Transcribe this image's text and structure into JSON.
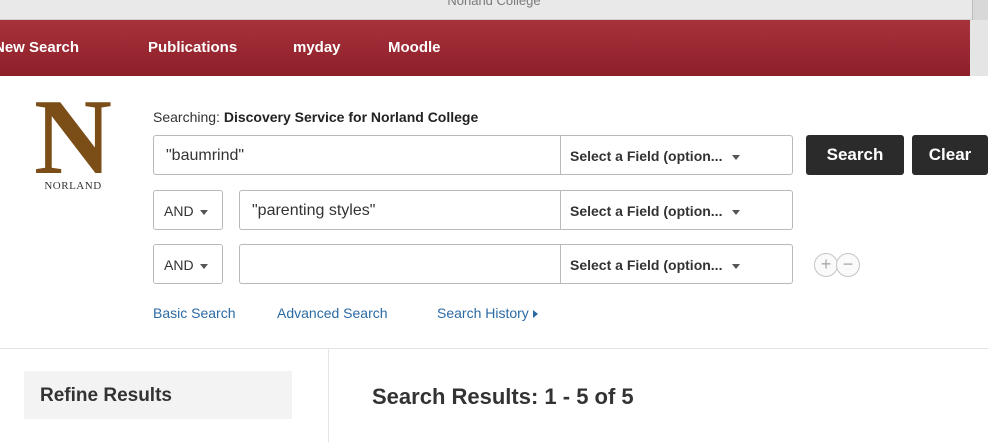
{
  "window": {
    "title": "Norland College"
  },
  "nav": {
    "items": [
      "New Search",
      "Publications",
      "myday",
      "Moodle"
    ]
  },
  "logo": {
    "letter": "N",
    "name": "NORLAND"
  },
  "search": {
    "searching_label": "Searching:",
    "searching_target": "Discovery Service for Norland College",
    "rows": [
      {
        "operator": "",
        "value": "\"baumrind\"",
        "field": "Select a Field (option..."
      },
      {
        "operator": "AND",
        "value": "\"parenting styles\"",
        "field": "Select a Field (option..."
      },
      {
        "operator": "AND",
        "value": "",
        "field": "Select a Field (option..."
      }
    ],
    "search_button": "Search",
    "clear_button": "Clear",
    "add_row": "+",
    "remove_row": "−"
  },
  "links": {
    "basic": "Basic Search",
    "advanced": "Advanced Search",
    "history": "Search History"
  },
  "sidebar": {
    "refine_title": "Refine Results"
  },
  "results": {
    "heading": "Search Results: 1 - 5 of 5"
  },
  "colors": {
    "nav_bar": "#9a2832",
    "logo": "#7b4e18",
    "link": "#2b6aa3",
    "dark_button": "#2b2b2b"
  }
}
